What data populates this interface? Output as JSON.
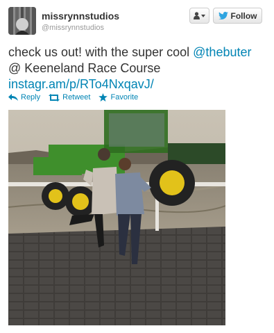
{
  "tweet": {
    "display_name": "missrynnstudios",
    "handle": "@missrynnstudios",
    "text_before_mention": "check us out! with the super cool ",
    "mention": "@thebuter",
    "text_after_mention": " @ Keeneland Race Course",
    "link": "instagr.am/p/RTo4NxqavJ/"
  },
  "buttons": {
    "follow_label": "Follow"
  },
  "actions": {
    "reply_label": "Reply",
    "retweet_label": "Retweet",
    "favorite_label": "Favorite"
  },
  "colors": {
    "link": "#0084b4",
    "twitter_blue": "#2ea4e0",
    "text": "#333333",
    "muted": "#999999",
    "tractor_green": "#3f8f2c",
    "tractor_yellow": "#e2c21a"
  },
  "icons": {
    "user_menu": "user-dropdown-icon",
    "follow": "twitter-bird-icon",
    "reply": "reply-arrow-icon",
    "retweet": "retweet-icon",
    "favorite": "star-icon"
  }
}
